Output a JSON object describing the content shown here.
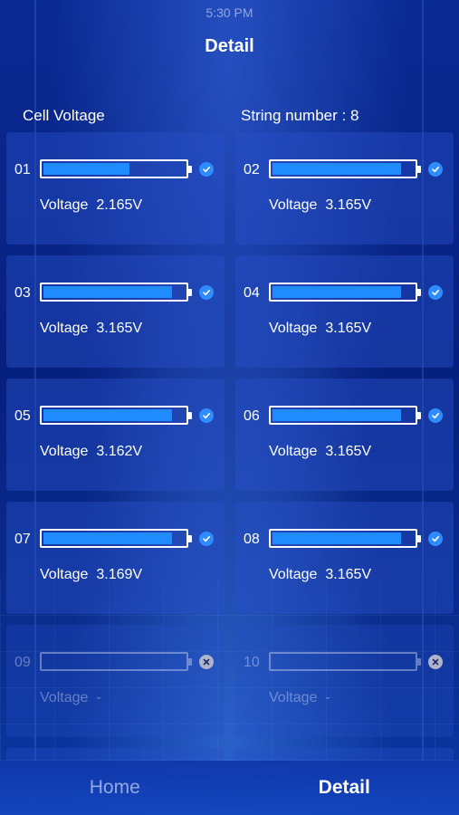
{
  "status_bar": {
    "time": "5:30 PM"
  },
  "header": {
    "title": "Detail"
  },
  "info": {
    "left_label": "Cell Voltage",
    "string_number": "String number : 8"
  },
  "colors": {
    "accent": "#1f8bff",
    "check": "#2f8cff",
    "inactive_icon": "#aeb4c9"
  },
  "cells": [
    {
      "num": "01",
      "label": "Voltage",
      "value": "2.165V",
      "level": 0.61,
      "status": "ok"
    },
    {
      "num": "02",
      "label": "Voltage",
      "value": "3.165V",
      "level": 0.91,
      "status": "ok"
    },
    {
      "num": "03",
      "label": "Voltage",
      "value": "3.165V",
      "level": 0.91,
      "status": "ok"
    },
    {
      "num": "04",
      "label": "Voltage",
      "value": "3.165V",
      "level": 0.91,
      "status": "ok"
    },
    {
      "num": "05",
      "label": "Voltage",
      "value": "3.162V",
      "level": 0.91,
      "status": "ok"
    },
    {
      "num": "06",
      "label": "Voltage",
      "value": "3.165V",
      "level": 0.91,
      "status": "ok"
    },
    {
      "num": "07",
      "label": "Voltage",
      "value": "3.169V",
      "level": 0.91,
      "status": "ok"
    },
    {
      "num": "08",
      "label": "Voltage",
      "value": "3.165V",
      "level": 0.91,
      "status": "ok"
    },
    {
      "num": "09",
      "label": "Voltage",
      "value": "-",
      "level": 0,
      "status": "off"
    },
    {
      "num": "10",
      "label": "Voltage",
      "value": "-",
      "level": 0,
      "status": "off"
    }
  ],
  "tabs": [
    {
      "label": "Home",
      "active": false
    },
    {
      "label": "Detail",
      "active": true
    }
  ]
}
